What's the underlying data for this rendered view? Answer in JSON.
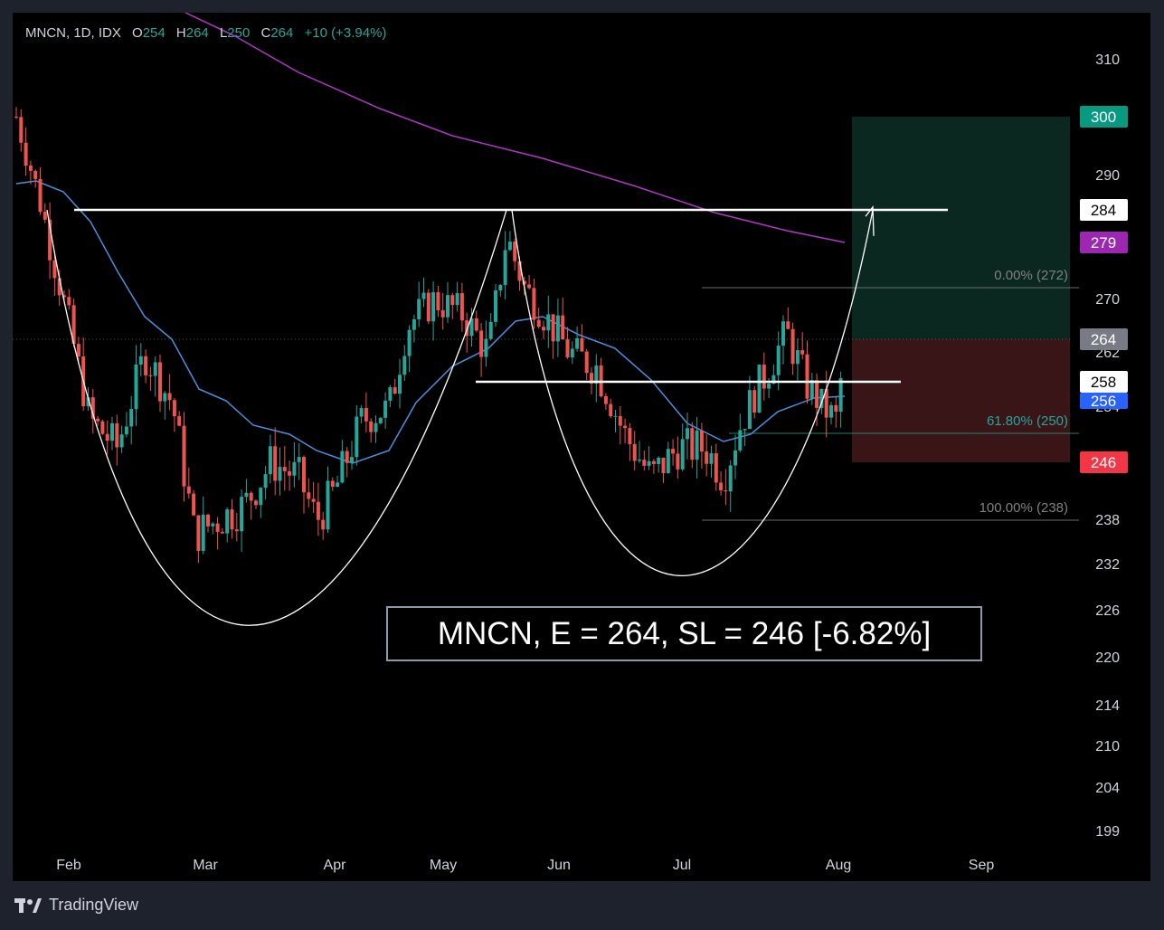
{
  "legend": {
    "symbol": "MNCN, 1D, IDX",
    "open_label": "O",
    "open": "254",
    "high_label": "H",
    "high": "264",
    "low_label": "L",
    "low": "250",
    "close_label": "C",
    "close": "264",
    "change": "+10 (+3.94%)"
  },
  "trade_label": "MNCN, E = 264, SL = 246 [-6.82%]",
  "brand": "TradingView",
  "colors": {
    "up": "#26a69a",
    "down": "#ef5350",
    "ma_fast": "#4a8fdd",
    "ma_slow": "#b038c6",
    "profit_zone": "#0b2820",
    "loss_zone": "#3a1518",
    "annotation": "#ffffff"
  },
  "chart_data": {
    "type": "candlestick",
    "title": "MNCN, 1D, IDX",
    "x_tick_labels": [
      "Feb",
      "Mar",
      "Apr",
      "May",
      "Jun",
      "Jul",
      "Aug",
      "Sep"
    ],
    "y_tick_labels": [
      310,
      290,
      270,
      262,
      254,
      238,
      232,
      226,
      220,
      214,
      210,
      204,
      199
    ],
    "ylim": [
      197,
      313
    ],
    "grid": false,
    "last_price": 264,
    "ohlc_summary": {
      "open": 254,
      "high": 264,
      "low": 250,
      "close": 264,
      "change": 10,
      "change_pct": 3.94
    },
    "closes_approx": [
      {
        "month": "Jan end",
        "close": 300
      },
      {
        "month": "Feb mid",
        "close": 260
      },
      {
        "month": "Mar early",
        "close": 240
      },
      {
        "month": "Mar end",
        "close": 238
      },
      {
        "month": "Apr end",
        "close": 268
      },
      {
        "month": "May peak",
        "close": 283
      },
      {
        "month": "Jun mid",
        "close": 255
      },
      {
        "month": "Jul early",
        "close": 242
      },
      {
        "month": "Jul end",
        "close": 268
      },
      {
        "month": "Aug early",
        "close": 264
      }
    ],
    "levels": [
      {
        "label": "300",
        "value": 300,
        "color": "#089981",
        "text_color": "#ffffff"
      },
      {
        "label": "284",
        "value": 284,
        "color": "#ffffff",
        "text_color": "#000000"
      },
      {
        "label": "279",
        "value": 279,
        "color": "#9c27b0",
        "text_color": "#ffffff"
      },
      {
        "label": "264",
        "value": 264,
        "color": "#787b86",
        "text_color": "#ffffff"
      },
      {
        "label": "258",
        "value": 258,
        "color": "#ffffff",
        "text_color": "#000000"
      },
      {
        "label": "256",
        "value": 256,
        "color": "#2962ff",
        "text_color": "#ffffff"
      },
      {
        "label": "246",
        "value": 246,
        "color": "#f23645",
        "text_color": "#ffffff"
      }
    ],
    "fibonacci": [
      {
        "label": "0.00% (272)",
        "value": 272
      },
      {
        "label": "61.80% (250)",
        "value": 250
      },
      {
        "label": "100.00% (238)",
        "value": 238
      }
    ],
    "annotations": {
      "resistance": 284,
      "handle_neckline": 258,
      "target": 300,
      "stop_loss": 246,
      "entry": 264
    }
  }
}
